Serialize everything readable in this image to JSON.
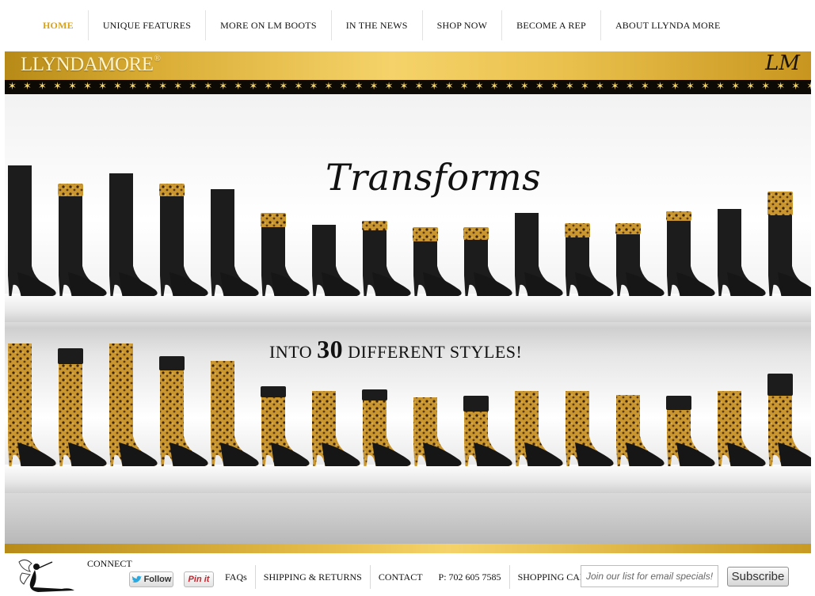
{
  "nav": {
    "items": [
      {
        "label": "HOME",
        "active": true
      },
      {
        "label": "UNIQUE FEATURES"
      },
      {
        "label": "MORE ON LM BOOTS"
      },
      {
        "label": "IN THE NEWS"
      },
      {
        "label": "SHOP NOW"
      },
      {
        "label": "BECOME A REP"
      },
      {
        "label": "ABOUT LLYNDA MORE"
      }
    ]
  },
  "banner": {
    "brand": "LLYNDAMORE",
    "brand_mark": "®",
    "monogram": "LM",
    "star_glyph": "✶"
  },
  "hero": {
    "headline": "Transforms",
    "caption_pre": "INTO",
    "caption_num": "30",
    "caption_post": "DIFFERENT STYLES!"
  },
  "footer": {
    "connect": "CONNECT",
    "follow_label": "Follow",
    "pin_label": "Pin it",
    "faqs": "FAQs",
    "shipping": "SHIPPING & RETURNS",
    "contact": "CONTACT",
    "phone": "P: 702 605 7585",
    "cart": "SHOPPING CART",
    "email_placeholder": "Join our list for email specials!",
    "subscribe": "Subscribe"
  },
  "colors": {
    "accent_gold": "#d8a21a",
    "banner_gold": "#f5d36a",
    "twitter_blue": "#2aa9e0",
    "pinterest_red": "#c8232c"
  }
}
